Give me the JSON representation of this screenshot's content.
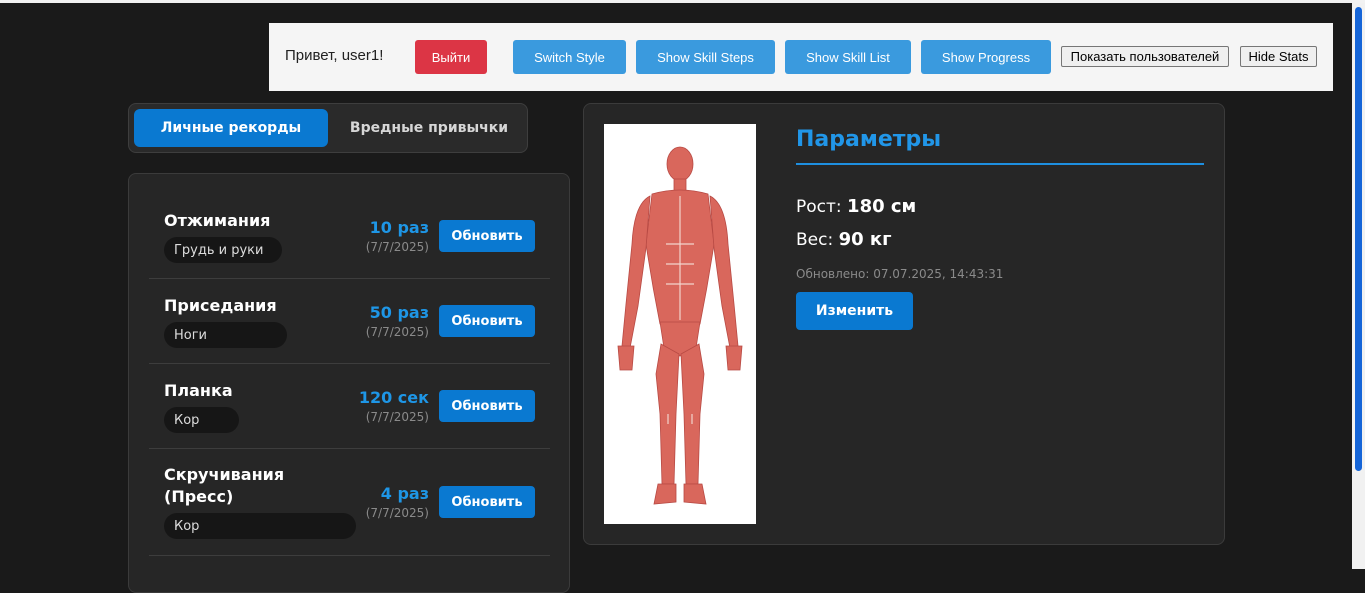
{
  "topbar": {
    "greeting": "Привет, user1!",
    "logout": "Выйти",
    "switch_style": "Switch Style",
    "show_skill_steps": "Show Skill Steps",
    "show_skill_list": "Show Skill List",
    "show_progress": "Show Progress",
    "show_users": "Показать пользователей",
    "hide_stats": "Hide Stats"
  },
  "tabs": [
    {
      "label": "Личные рекорды",
      "active": true
    },
    {
      "label": "Вредные привычки",
      "active": false
    }
  ],
  "records": [
    {
      "name": "Отжимания",
      "tag": "Грудь и руки",
      "value": "10 раз",
      "date": "(7/7/2025)",
      "button": "Обновить"
    },
    {
      "name": "Приседания",
      "tag": "Ноги",
      "value": "50 раз",
      "date": "(7/7/2025)",
      "button": "Обновить"
    },
    {
      "name": "Планка",
      "tag": "Кор",
      "value": "120 сек",
      "date": "(7/7/2025)",
      "button": "Обновить"
    },
    {
      "name_line1": "Скручивания",
      "name_line2": "(Пресс)",
      "tag": "Кор",
      "value": "4 раз",
      "date": "(7/7/2025)",
      "button": "Обновить"
    }
  ],
  "params": {
    "title": "Параметры",
    "height_label": "Рост:",
    "height_value": "180 см",
    "weight_label": "Вес:",
    "weight_value": "90 кг",
    "updated": "Обновлено: 07.07.2025, 14:43:31",
    "edit_button": "Изменить",
    "image_icon": "muscle-anatomy-figure"
  },
  "colors": {
    "accent": "#0a79d1",
    "value_blue": "#1e96e6",
    "danger": "#dc3545",
    "background": "#1a1a1a"
  }
}
